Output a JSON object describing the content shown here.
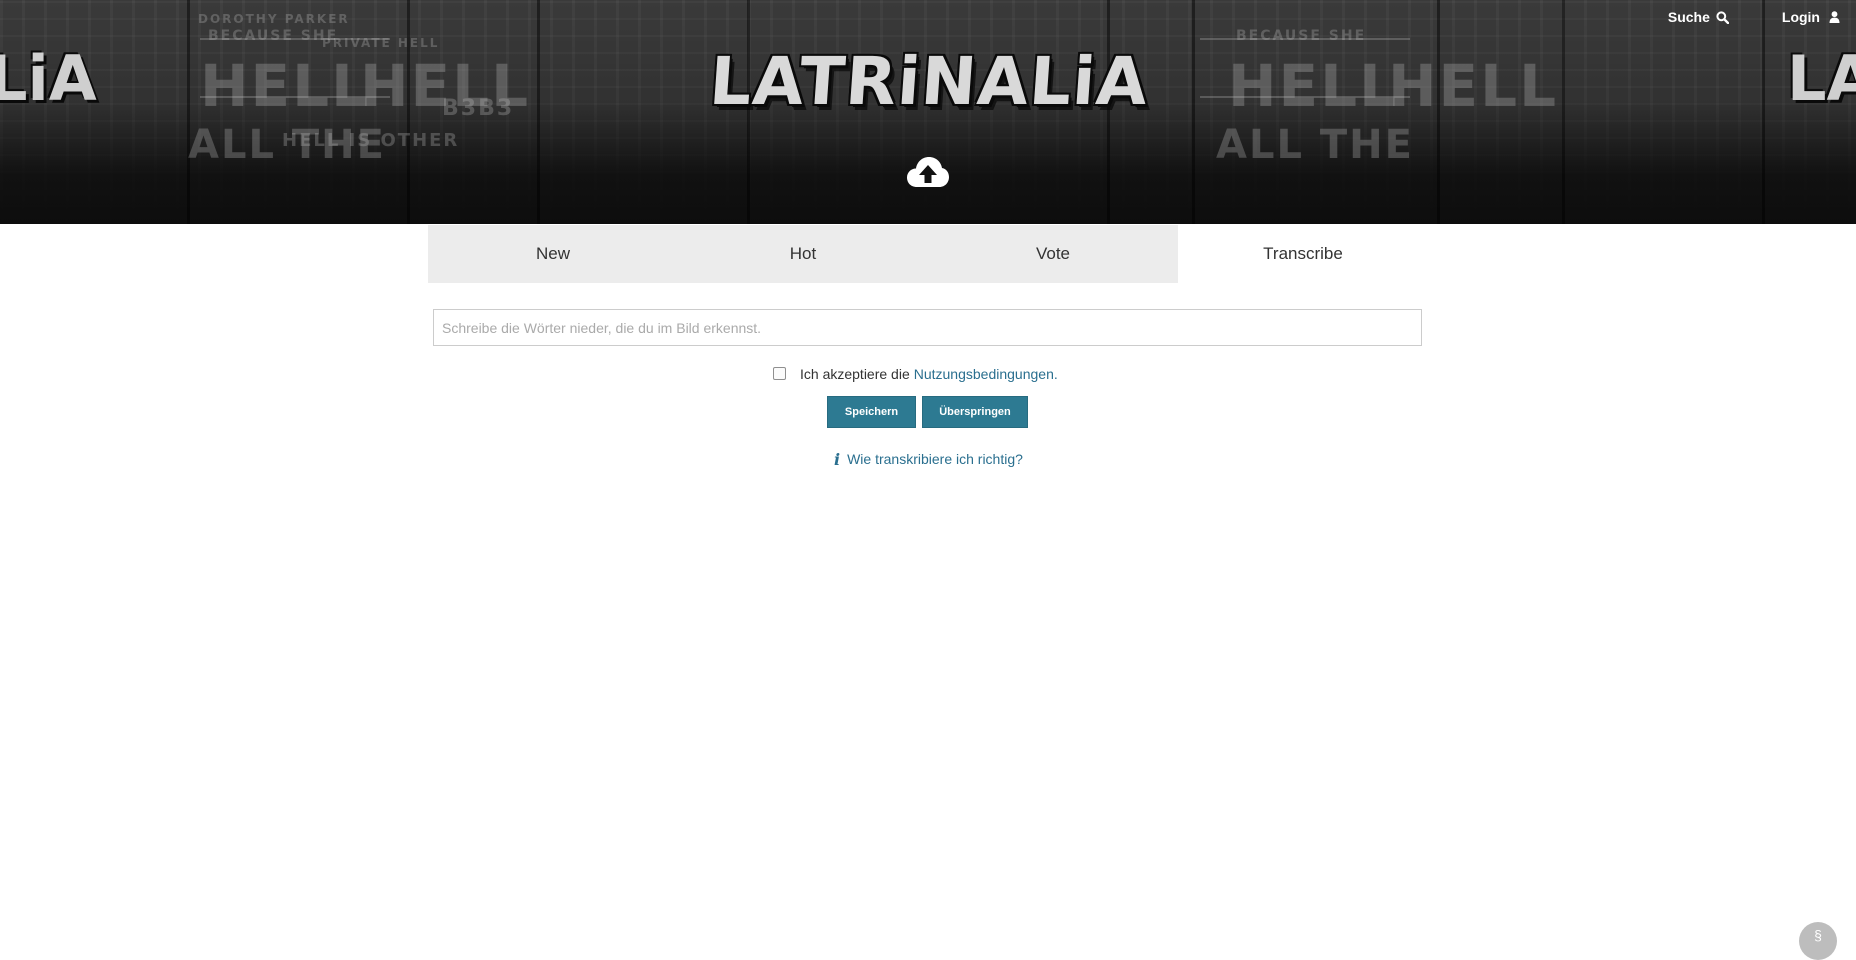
{
  "header": {
    "logo_text": "LATRiNALiA",
    "logo_left_fragment": "LiA",
    "logo_right_fragment": "LA",
    "upload_icon": "cloud-upload-icon",
    "nav": {
      "search_label": "Suche",
      "search_icon": "search-icon",
      "login_label": "Login",
      "login_icon": "user-icon"
    },
    "graffiti": [
      "HELL",
      "HELL",
      "ALL THE",
      "HELL IS OTHER",
      "DOROTHY PARKER",
      "BECAUSE SHE",
      "PRIVATE HELL",
      "B3B3",
      "HELL",
      "HELL",
      "ALL THE",
      "BECAUSE SHE"
    ]
  },
  "tabs": [
    {
      "label": "New",
      "active": false
    },
    {
      "label": "Hot",
      "active": false
    },
    {
      "label": "Vote",
      "active": false
    },
    {
      "label": "Transcribe",
      "active": true
    }
  ],
  "form": {
    "input_placeholder": "Schreibe die Wörter nieder, die du im Bild erkennst.",
    "input_value": "",
    "terms_prefix": "Ich akzeptiere die",
    "terms_link": "Nutzungsbedingungen",
    "terms_suffix": ".",
    "terms_checked": false,
    "save_label": "Speichern",
    "skip_label": "Überspringen",
    "help_icon": "info-icon",
    "help_label": "Wie transkribiere ich richtig?"
  },
  "corner_badge": {
    "icon": "section-icon",
    "label": "§"
  },
  "colors": {
    "accent": "#2d7a92",
    "link": "#2a6f8f",
    "tab_bg": "#ececec",
    "header_dark": "#0d0d0d"
  }
}
